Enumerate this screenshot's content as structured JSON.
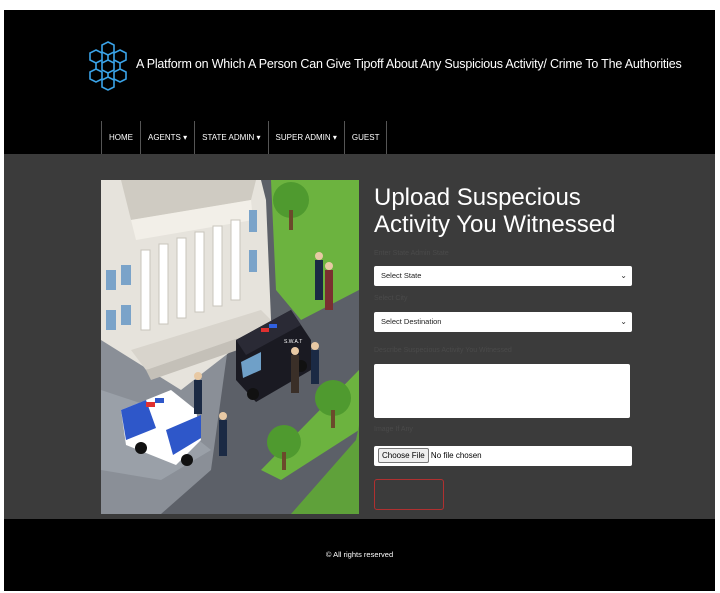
{
  "header": {
    "title": "A Platform on Which A Person Can Give Tipoff About Any Suspicious Activity/ Crime To The Authorities"
  },
  "nav": {
    "items": [
      "HOME",
      "AGENTS ▾",
      "STATE ADMIN ▾",
      "SUPER ADMIN ▾",
      "GUEST"
    ]
  },
  "form": {
    "title_line1": "Upload Suspecious",
    "title_line2": "Activity You Witnessed",
    "state_label": "Enter State Admin State",
    "state_value": "Select State",
    "city_label": "Select City",
    "city_value": "Select Destination",
    "desc_label": "Describe Suspecious Activity You Witnessed",
    "desc_value": "",
    "image_label": "Image If Any",
    "file_button": "Choose File",
    "file_status": "No file chosen",
    "submit_label": ""
  },
  "illustration": {
    "van_label": "S.W.A.T"
  },
  "footer": {
    "copyright": "© All rights reserved"
  },
  "colors": {
    "page_bg": "#000000",
    "content_bg": "#3b3b3b",
    "logo": "#3aa3e8",
    "submit_border": "#b03030"
  }
}
